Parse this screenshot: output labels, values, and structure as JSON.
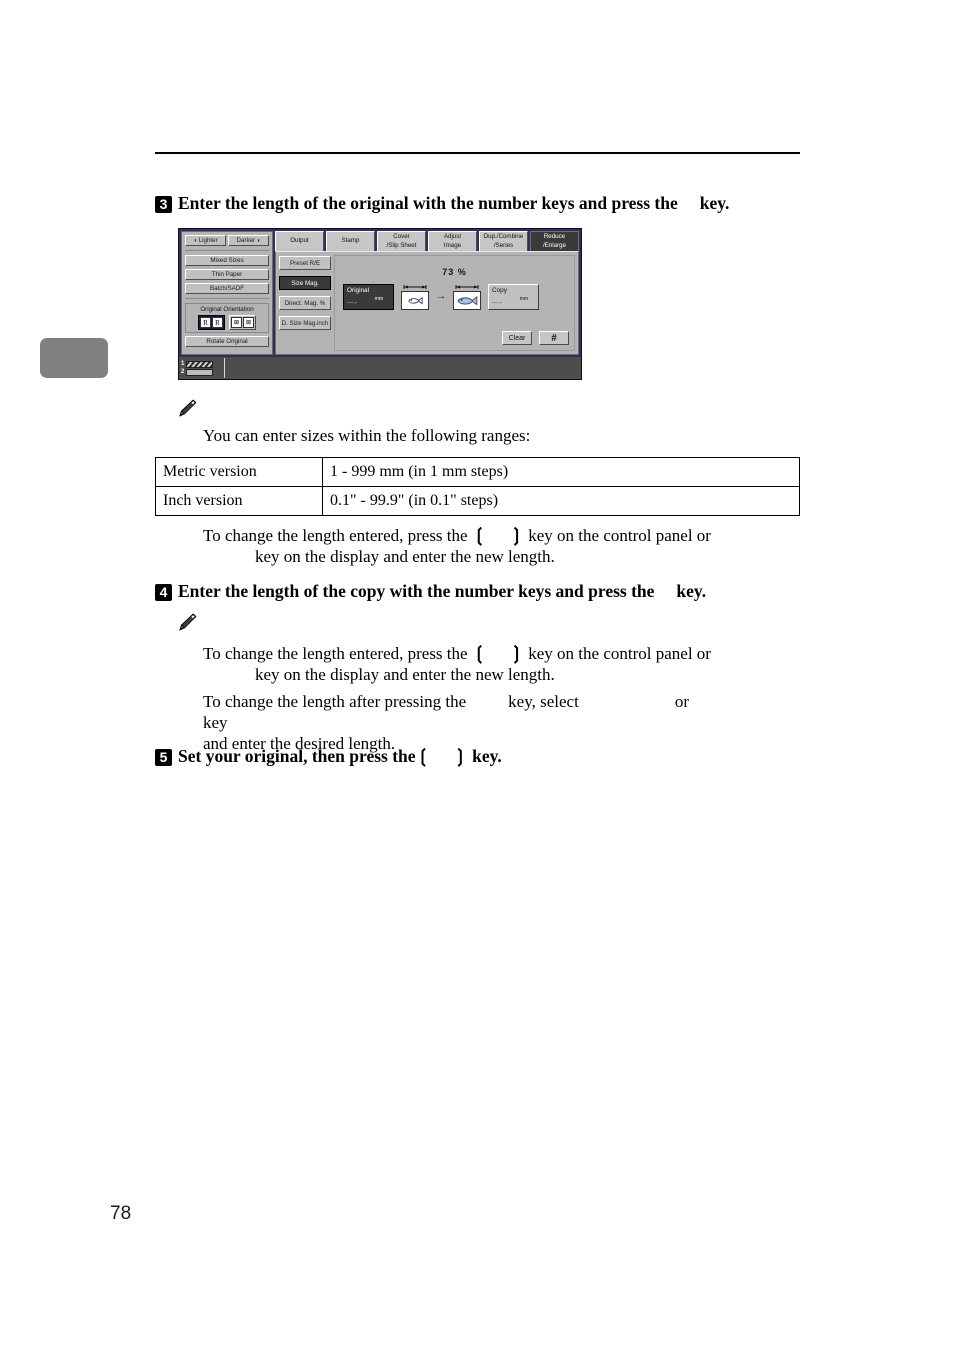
{
  "page": {
    "number": "78"
  },
  "steps": {
    "step3": {
      "num": "3",
      "text_before": "Enter the length of the original with the number keys and press the",
      "text_after": "key."
    },
    "step4": {
      "num": "4",
      "text_before": "Enter the length of the copy with the number keys and press the",
      "text_after": "key."
    },
    "step5": {
      "num": "5",
      "text_before": "Set your original, then press the",
      "bracket_open": "❲",
      "bracket_close": "❳",
      "text_after": "key."
    }
  },
  "note1": {
    "icon": "pencil-icon",
    "lede": "You can enter sizes within the following ranges:",
    "table": {
      "rows": [
        {
          "label": "Metric version",
          "value": "1 - 999 mm (in 1 mm steps)"
        },
        {
          "label": "Inch version",
          "value": "0.1\" - 99.9\" (in 0.1\" steps)"
        }
      ]
    },
    "change_para": {
      "l1a": "To change the length entered, press the",
      "bracket_open": "❲",
      "bracket_close": "❳",
      "l1b": "key on the control panel or",
      "l2": "key on the display and enter the new length."
    }
  },
  "note2": {
    "icon": "pencil-icon",
    "change_para": {
      "l1a": "To change the length entered, press the",
      "bracket_open": "❲",
      "bracket_close": "❳",
      "l1b": "key on the control panel or",
      "l2": "key on the display and enter the new length."
    },
    "after_para": {
      "l1a": "To change the length after pressing the",
      "l1b": "key, select",
      "l1c": "or",
      "l1d": "key",
      "l2": "and enter the desired length."
    }
  },
  "panel": {
    "colors": {
      "frame": "#2e2e62",
      "face": "#b4b4b4",
      "button": "#c0c0c0",
      "selected": "#3a3a3a",
      "foot": "#4d4d4d"
    },
    "left": {
      "lighter": "Lighter",
      "darker": "Darker",
      "lighter_icon": "left-arrow-icon",
      "darker_icon": "right-arrow-icon",
      "buttons": [
        "Mixed Sizes",
        "Thin Paper",
        "Batch/SADF"
      ],
      "orientation_title": "Original Orientation",
      "orientation_icons": [
        "R",
        "R",
        "R",
        "R"
      ],
      "rotate": "Rotate Original"
    },
    "tabs": [
      {
        "label": "Output",
        "line2": "",
        "selected": false
      },
      {
        "label": "Stamp",
        "line2": "",
        "selected": false
      },
      {
        "label": "Cover",
        "line2": "/Slip Sheet",
        "selected": false
      },
      {
        "label": "Adjust",
        "line2": "Image",
        "selected": false
      },
      {
        "label": "Dup./Combine",
        "line2": "/Series",
        "selected": false
      },
      {
        "label": "Reduce",
        "line2": "/Enlarge",
        "selected": true
      }
    ],
    "side_buttons": [
      {
        "label": "Preset R/E",
        "selected": false
      },
      {
        "label": "Size Mag.",
        "selected": true
      },
      {
        "label": "Direct. Mag. %",
        "selected": false
      },
      {
        "label": "D. Size Mag.inch",
        "selected": false
      }
    ],
    "stage": {
      "ratio": "73 %",
      "original": {
        "label": "Original",
        "value": "---.-",
        "unit": "mm"
      },
      "copy": {
        "label": "Copy",
        "value": "---.-",
        "unit": "mm"
      },
      "arrow": "→",
      "fish_icon_from": "fish-small-icon",
      "fish_icon_to": "fish-large-icon",
      "clear": "Clear",
      "hash": "#"
    },
    "foot": {
      "tray1": "1",
      "tray2": "2"
    }
  }
}
